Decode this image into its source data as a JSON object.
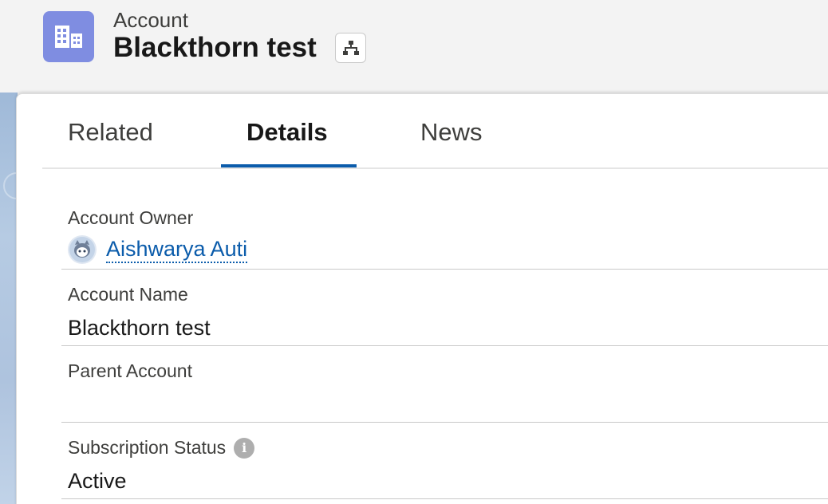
{
  "header": {
    "object_label": "Account",
    "record_title": "Blackthorn test",
    "object_icon": "building-icon",
    "hierarchy_icon": "hierarchy-icon"
  },
  "tabs": [
    {
      "label": "Related",
      "active": false
    },
    {
      "label": "Details",
      "active": true
    },
    {
      "label": "News",
      "active": false
    }
  ],
  "fields": {
    "owner": {
      "label": "Account Owner",
      "value": "Aishwarya Auti"
    },
    "name": {
      "label": "Account Name",
      "value": "Blackthorn test"
    },
    "parent": {
      "label": "Parent Account",
      "value": ""
    },
    "subscription": {
      "label": "Subscription Status",
      "value": "Active"
    }
  },
  "colors": {
    "accent": "#0b5cab",
    "object_icon_bg": "#7f8de1"
  }
}
